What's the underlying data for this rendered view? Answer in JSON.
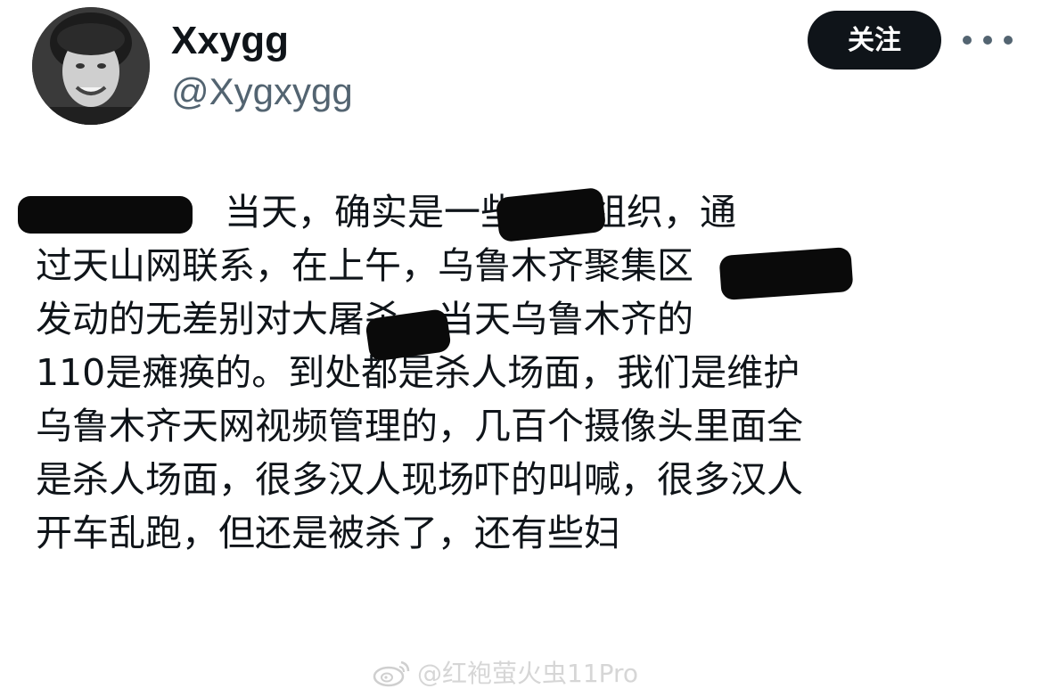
{
  "profile": {
    "display_name": "Xxygg",
    "handle": "@Xygxygg"
  },
  "actions": {
    "follow_label": "关注"
  },
  "tweet": {
    "lines": [
      "当天，确实是一些恐怖组织，通",
      "过天山网联系，在上午，乌鲁木齐聚集区",
      "发动的无差别对大屠杀。当天乌鲁木齐的",
      "110是瘫痪的。到处都是杀人场面，我们是维护",
      "乌鲁木齐天网视频管理的，几百个摄像头里面全",
      "是杀人场面，很多汉人现场吓的叫喊，很多汉人",
      "开车乱跑，但还是被杀了，还有些妇"
    ]
  },
  "watermark": {
    "text": "@红袍萤火虫11Pro",
    "icon": "weibo-icon"
  }
}
